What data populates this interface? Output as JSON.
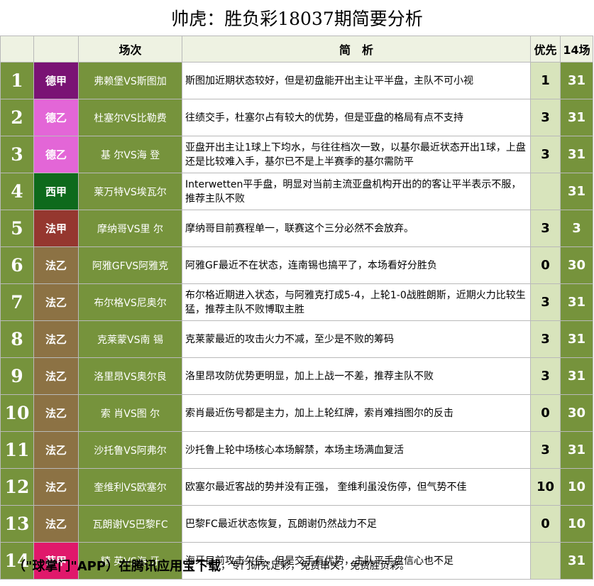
{
  "title": "帅虎：胜负彩18037期简要分析",
  "headers": {
    "num": "",
    "league": "",
    "match": "场次",
    "analysis": "简　析",
    "pref": "优先",
    "count": "14场"
  },
  "colors": {
    "num_bg": "#76933c",
    "match_bg": "#76933c",
    "pref_bg": "#d8e4bc",
    "score_bg": "#76933c",
    "德甲": "#7a1374",
    "德乙": "#e366d7",
    "西甲": "#0e6a1c",
    "法甲": "#95372f",
    "法乙": "#8c7244",
    "荷甲": "#e0186b"
  },
  "rows": [
    {
      "num": "1",
      "league": "德甲",
      "match": "弗赖堡VS斯图加",
      "analysis": "斯图加近期状态较好，但是初盘能开出主让平半盘，主队不可小视",
      "pref": "1",
      "count": "31"
    },
    {
      "num": "2",
      "league": "德乙",
      "match": "杜塞尔VS比勒费",
      "analysis": "往绩交手，杜塞尔占有较大的优势，但是亚盘的格局有点不支持",
      "pref": "3",
      "count": "31"
    },
    {
      "num": "3",
      "league": "德乙",
      "match": "基 尔VS海 登",
      "analysis": "亚盘开出主让1球上下均水，与往往档次一致，以基尔最近状态开出1球，上盘还是比较难入手，基尔已不是上半赛季的基尔需防平",
      "pref": "3",
      "count": "31"
    },
    {
      "num": "4",
      "league": "西甲",
      "match": "莱万特VS埃瓦尔",
      "analysis": "Interwetten平手盘，明显对当前主流亚盘机构开出的的客让平半表示不服，推荐主队不败",
      "pref": "",
      "count": "31"
    },
    {
      "num": "5",
      "league": "法甲",
      "match": "摩纳哥VS里 尔",
      "analysis": "摩纳哥目前赛程单一，联赛这个三分必然不会放弃。",
      "pref": "3",
      "count": "3"
    },
    {
      "num": "6",
      "league": "法乙",
      "match": "阿雅GFVS阿雅克",
      "analysis": "阿雅GF最近不在状态，连南锡也搞平了，本场看好分胜负",
      "pref": "0",
      "count": "30"
    },
    {
      "num": "7",
      "league": "法乙",
      "match": "布尔格VS尼奥尔",
      "analysis": "布尔格近期进入状态，与阿雅克打成5-4，上轮1-0战胜朗斯，近期火力比较生猛，推荐主队不败博取主胜",
      "pref": "3",
      "count": "31"
    },
    {
      "num": "8",
      "league": "法乙",
      "match": "克莱蒙VS南 锡",
      "analysis": "克莱蒙最近的攻击火力不减，至少是不败的筹码",
      "pref": "3",
      "count": "31"
    },
    {
      "num": "9",
      "league": "法乙",
      "match": "洛里昂VS奥尔良",
      "analysis": "洛里昂攻防优势更明显，加上上战一不差，推荐主队不败",
      "pref": "3",
      "count": "31"
    },
    {
      "num": "10",
      "league": "法乙",
      "match": "索 肖VS图 尔",
      "analysis": "索肖最近伤号都是主力，加上上轮红牌，索肖难挡图尔的反击",
      "pref": "0",
      "count": "30"
    },
    {
      "num": "11",
      "league": "法乙",
      "match": "沙托鲁VS阿弗尔",
      "analysis": "沙托鲁上轮中场核心本场解禁，本场主场满血复活",
      "pref": "3",
      "count": "31"
    },
    {
      "num": "12",
      "league": "法乙",
      "match": "奎维利VS欧塞尔",
      "analysis": "欧塞尔最近客战的势并没有正强， 奎维利虽没伤停，但气势不佳",
      "pref": "10",
      "count": "10"
    },
    {
      "num": "13",
      "league": "法乙",
      "match": "瓦朗谢VS巴黎FC",
      "analysis": "巴黎FC最近状态恢复，瓦朗谢仍然战力不足",
      "pref": "0",
      "count": "10"
    },
    {
      "num": "14",
      "league": "荷甲",
      "match": "精 英VS海 牙",
      "analysis": "海牙目前攻击欠佳，但是交手有优势，主队平手盘信心也不足",
      "pref": "",
      "count": "31"
    }
  ],
  "footer": {
    "part1": "（\"球掌门\"APP）在腾讯应用宝下载",
    "part2": "，专门研究足彩，免费串关，免费胜负彩。"
  }
}
